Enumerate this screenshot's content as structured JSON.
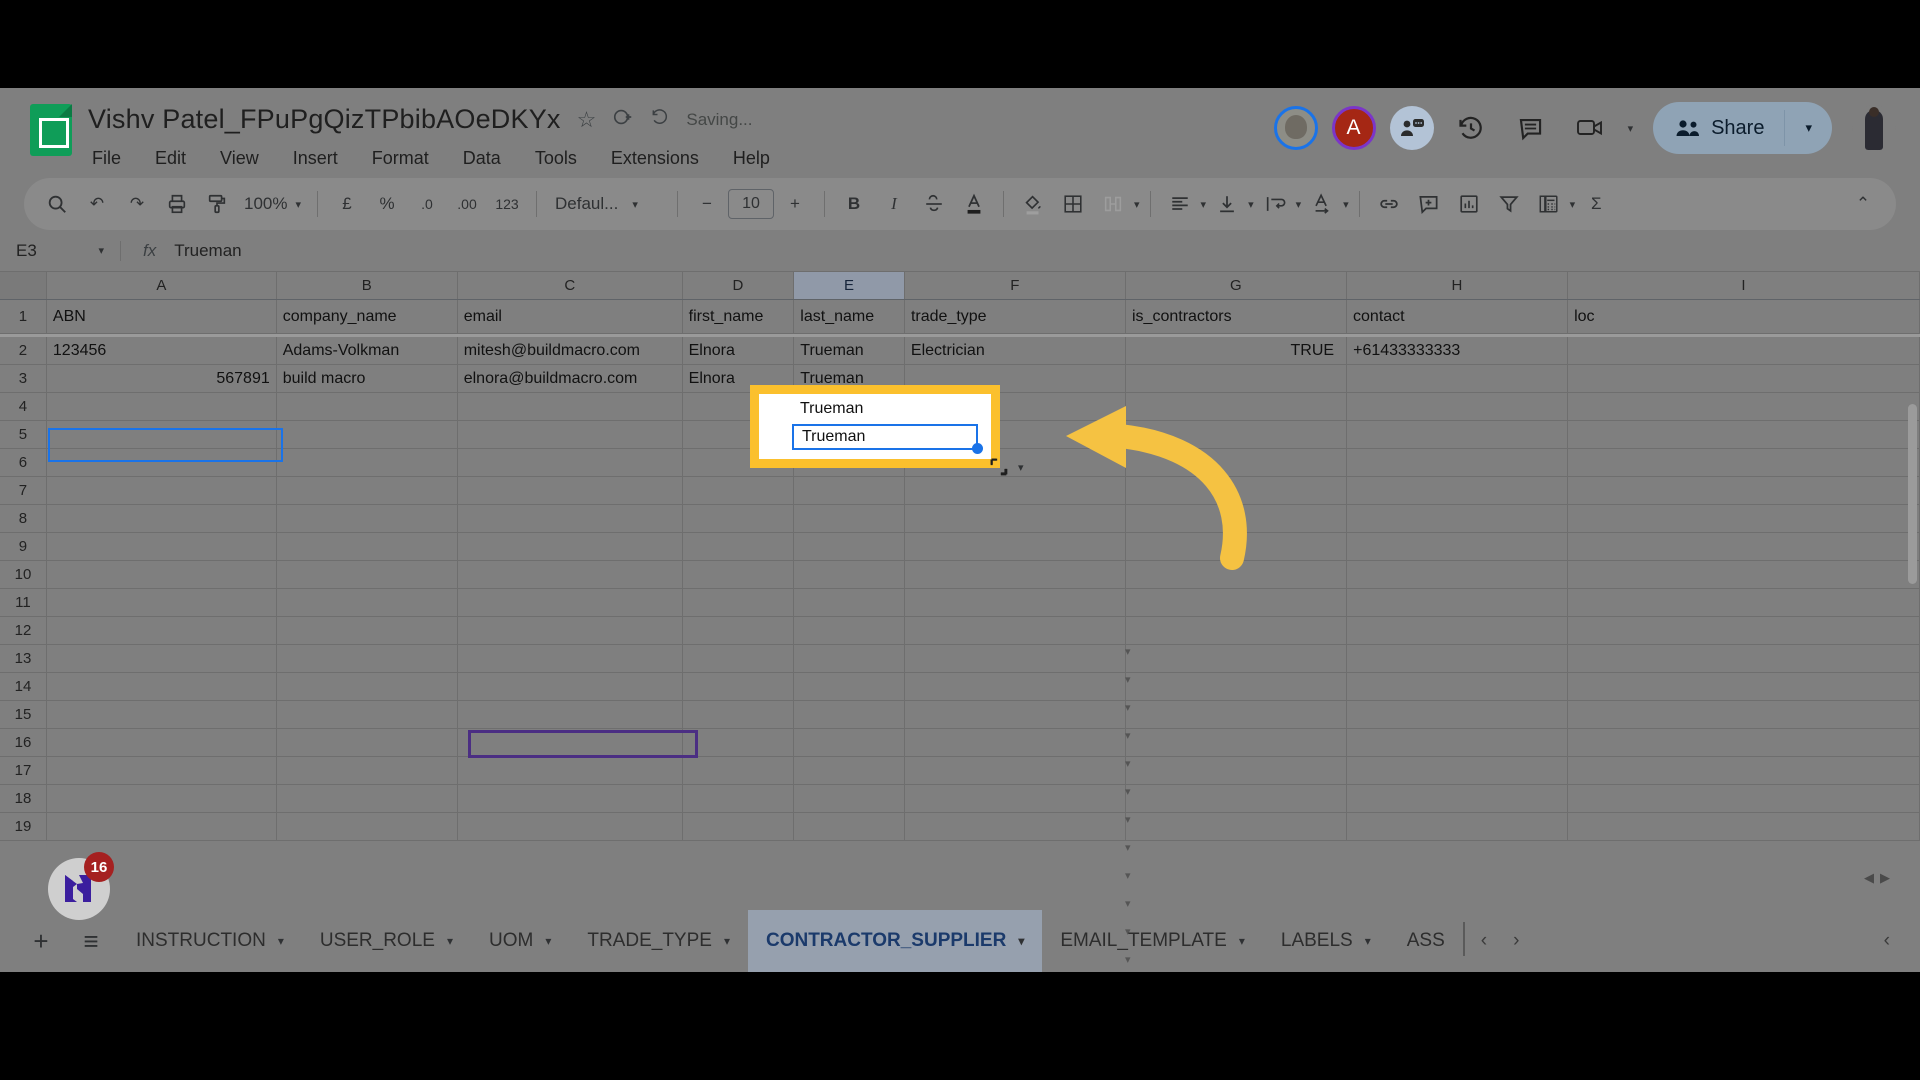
{
  "app": {
    "title": "Vishv Patel_FPuPgQizTPbibAOeDKYx",
    "save_status": "Saving...",
    "star_icon": "star-icon",
    "drive_icon": "move-to-drive-icon",
    "history_status_icon": "version-history-icon"
  },
  "menu": {
    "items": [
      "File",
      "Edit",
      "View",
      "Insert",
      "Format",
      "Data",
      "Tools",
      "Extensions",
      "Help"
    ]
  },
  "header_right": {
    "collaborator_a": "A",
    "present_label": "present-icon",
    "history_label": "history-icon",
    "comment_label": "comment-icon",
    "meet_label": "meet-icon",
    "share_label": "Share",
    "share_caret": "▾"
  },
  "toolbar": {
    "search": "⌕",
    "undo": "↶",
    "redo": "↷",
    "print": "⎙",
    "paint": "paint-format-icon",
    "zoom": "100%",
    "currency": "£",
    "percent": "%",
    "dec_decrease": ".0",
    "dec_increase": ".00",
    "more_formats": "123",
    "font": "Defaul...",
    "font_size": "10",
    "minus": "−",
    "plus": "+",
    "bold": "B",
    "italic": "I",
    "strikethrough": "S",
    "text_color": "A",
    "fill_color": "fill-color-icon",
    "borders": "borders-icon",
    "merge": "merge-cells-icon",
    "halign": "align-left-icon",
    "valign": "align-bottom-icon",
    "wrap": "text-wrap-icon",
    "rotate": "text-rotation-icon",
    "link": "link-icon",
    "comment": "insert-comment-icon",
    "chart": "insert-chart-icon",
    "filter": "filter-icon",
    "functions": "functions-icon",
    "sum": "Σ",
    "collapse": "⌃",
    "caret": "▾"
  },
  "formula_bar": {
    "name_box": "E3",
    "fx": "fx",
    "value": "Trueman"
  },
  "grid": {
    "columns": [
      "A",
      "B",
      "C",
      "D",
      "E",
      "F",
      "G",
      "H",
      "I"
    ],
    "selected_column": "E",
    "rows": [
      "1",
      "2",
      "3",
      "4",
      "5",
      "6",
      "7",
      "8",
      "9",
      "10",
      "11",
      "12",
      "13",
      "14",
      "15",
      "16",
      "17",
      "18",
      "19"
    ],
    "data": [
      {
        "row": "1",
        "A": "ABN",
        "B": "company_name",
        "C": "email",
        "D": "first_name",
        "E": "last_name",
        "F": "trade_type",
        "G": "is_contractors",
        "H": "contact",
        "I": "loc"
      },
      {
        "row": "2",
        "A": "123456",
        "B": "Adams-Volkman",
        "C": "mitesh@buildmacro.com",
        "D": "Elnora",
        "E": "Trueman",
        "F": "Electrician",
        "G": "TRUE",
        "H": "+61433333333",
        "I": ""
      },
      {
        "row": "3",
        "A": "567891",
        "B": "build macro",
        "C": "elnora@buildmacro.com",
        "D": "Elnora",
        "E": "Trueman",
        "F": "",
        "G": "",
        "H": "",
        "I": ""
      }
    ],
    "selected_cell": "E3",
    "selected_cell_value": "Trueman",
    "a1_outline": "A1",
    "c11_outline": "C11",
    "paste_options_icon": "paste-options-icon"
  },
  "annotation": {
    "highlight_box": "highlight-rectangle",
    "arrow": "curved-arrow-pointing-left",
    "arrow_color": "#F5C242"
  },
  "overlay_widget": {
    "badge_count": "16",
    "logo": "M"
  },
  "sheet_tabs": {
    "add": "+",
    "all_sheets": "≡",
    "tabs": [
      {
        "label": "INSTRUCTION",
        "active": false
      },
      {
        "label": "USER_ROLE",
        "active": false
      },
      {
        "label": "UOM",
        "active": false
      },
      {
        "label": "TRADE_TYPE",
        "active": false
      },
      {
        "label": "CONTRACTOR_SUPPLIER",
        "active": true
      },
      {
        "label": "EMAIL_TEMPLATE",
        "active": false
      },
      {
        "label": "LABELS",
        "active": false
      },
      {
        "label": "ASS",
        "active": false
      }
    ],
    "prev": "‹",
    "next": "›",
    "collapse": "‹"
  },
  "colors": {
    "sheets_green": "#0f9d58",
    "selection_blue": "#1a73e8",
    "highlight_yellow": "#FBC02D",
    "active_tab_text": "#1b3a6b",
    "badge_red": "#a52020"
  }
}
